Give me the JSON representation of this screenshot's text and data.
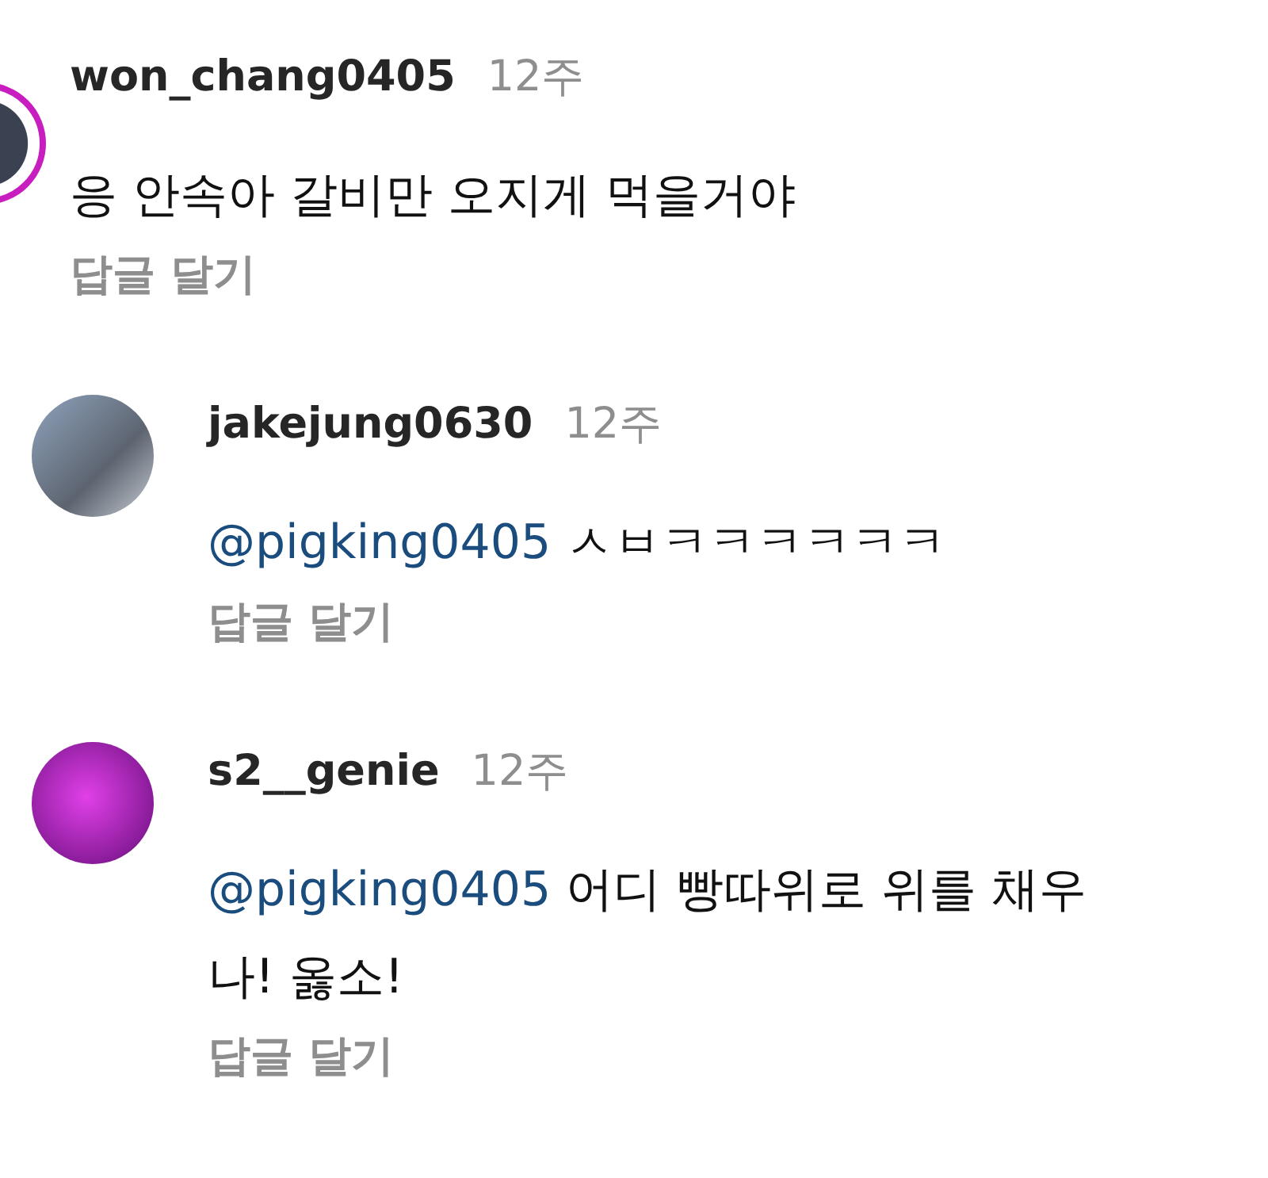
{
  "comments": [
    {
      "username": "won_chang0405",
      "time": "12주",
      "text": "응 안속아 갈비만 오지게 먹을거야",
      "reply_action": "답글 달기",
      "story_ring": true,
      "children": [
        {
          "username": "jakejung0630",
          "time": "12주",
          "mention": "@pigking0405",
          "text": "ㅅㅂㅋㅋㅋㅋㅋㅋ",
          "reply_action": "답글 달기",
          "story_ring": false
        },
        {
          "username": "s2__genie",
          "time": "12주",
          "mention": "@pigking0405",
          "text": "어디 빵따위로 위를 채우나! 옳소!",
          "reply_action": "답글 달기",
          "story_ring": false
        }
      ]
    }
  ]
}
